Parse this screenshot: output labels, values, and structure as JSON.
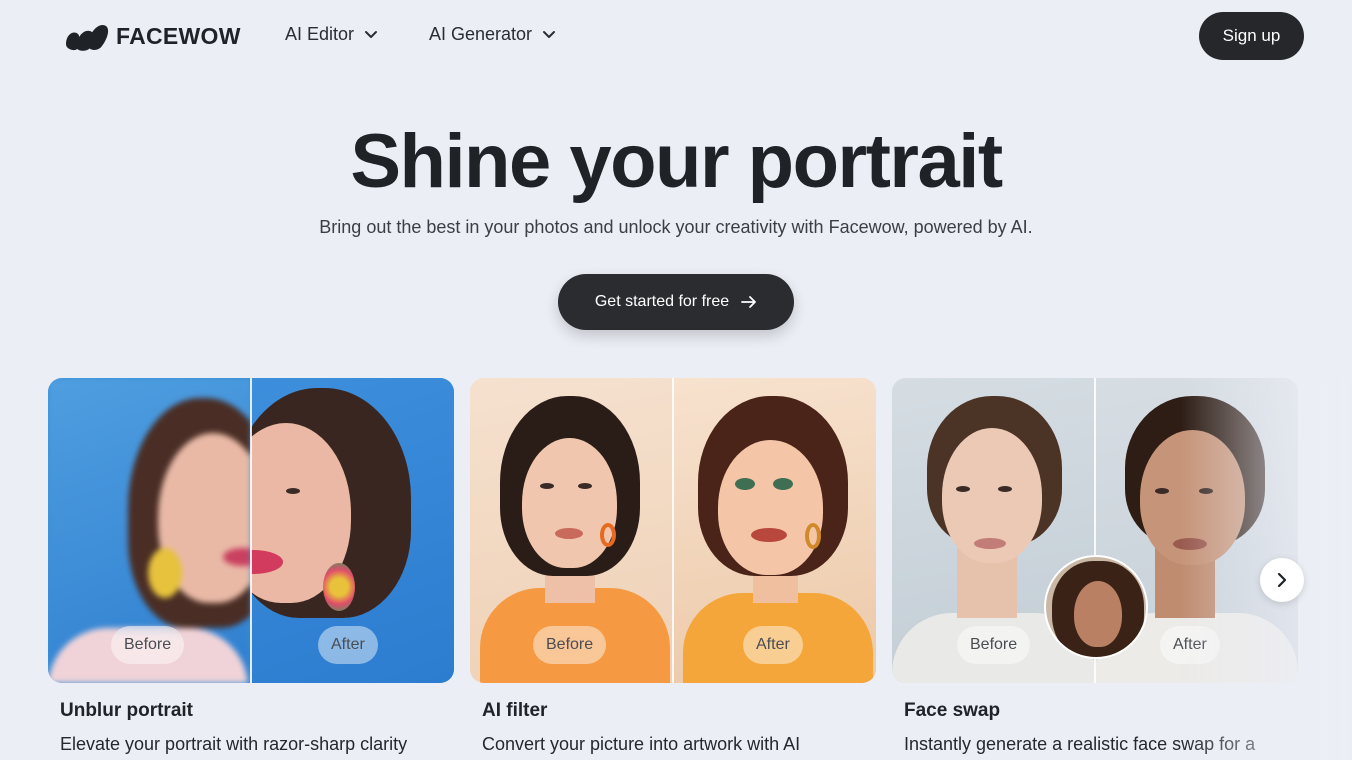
{
  "nav": {
    "logo_text": "FACEWOW",
    "menu": [
      {
        "label": "AI Editor"
      },
      {
        "label": "AI Generator"
      }
    ],
    "signup_label": "Sign up"
  },
  "hero": {
    "title": "Shine your portrait",
    "subtitle": "Bring out the best in your photos and unlock your creativity with Facewow, powered by AI.",
    "cta_label": "Get started for free"
  },
  "cards": [
    {
      "title": "Unblur portrait",
      "description": "Elevate your portrait with razor-sharp clarity",
      "before_label": "Before",
      "after_label": "After"
    },
    {
      "title": "AI filter",
      "description": "Convert your picture into artwork with AI",
      "before_label": "Before",
      "after_label": "After"
    },
    {
      "title": "Face swap",
      "description": "Instantly generate a realistic face swap for a",
      "before_label": "Before",
      "after_label": "After"
    }
  ],
  "colors": {
    "background": "#eceef6",
    "dark_button": "#25272b",
    "text": "#1f2226"
  },
  "icons": {
    "logo": "facewow-logo-icon",
    "dropdown": "chevron-down-icon",
    "cta_arrow": "arrow-right-icon",
    "carousel_next": "chevron-right-icon"
  }
}
